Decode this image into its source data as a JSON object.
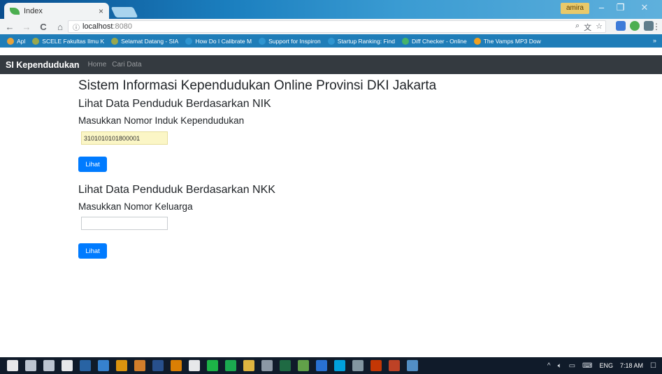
{
  "browser": {
    "tab_title": "Index",
    "tab_close": "×",
    "window_user": "amira",
    "window_buttons": {
      "minimize": "–",
      "maximize": "❐",
      "close": "✕"
    },
    "address": {
      "host": "localhost",
      "port": ":8080"
    },
    "nav_icons": {
      "back": "←",
      "forward": "→",
      "reload": "C",
      "home": "⌂",
      "info": "ⓘ"
    },
    "omnibox_icons": [
      "zoom-icon",
      "translate-icon",
      "star-icon"
    ],
    "bookmarks": [
      {
        "label": "Apl",
        "icon": "apps-icon",
        "color": "#e8a33a"
      },
      {
        "label": "SCELE Fakultas Ilmu K",
        "icon": "scele-icon",
        "color": "#9aa84d"
      },
      {
        "label": "Selamat Datang - SIA",
        "icon": "siak-icon",
        "color": "#9aa84d"
      },
      {
        "label": "How Do I Calibrate M",
        "icon": "page-icon",
        "color": "#2f95d0"
      },
      {
        "label": "Support for Inspiron",
        "icon": "dell-icon",
        "color": "#2f95d0"
      },
      {
        "label": "Startup Ranking: Find",
        "icon": "startup-icon",
        "color": "#2f95d0"
      },
      {
        "label": "Diff Checker - Online",
        "icon": "diff-icon",
        "color": "#46b36a"
      },
      {
        "label": "The Vamps MP3 Dow",
        "icon": "music-icon",
        "color": "#f0a020"
      }
    ],
    "bookmarks_more": "»"
  },
  "navbar": {
    "brand": "SI Kependudukan",
    "links": [
      "Home",
      "Cari Data"
    ]
  },
  "main": {
    "title": "Sistem Informasi Kependudukan Online Provinsi DKI Jakarta",
    "nik_section": {
      "heading": "Lihat Data Penduduk Berdasarkan NIK",
      "label": "Masukkan Nomor Induk Kependudukan",
      "value": "3101010101800001",
      "button": "Lihat"
    },
    "nkk_section": {
      "heading": "Lihat Data Penduduk Berdasarkan NKK",
      "label": "Masukkan Nomor Keluarga",
      "value": "",
      "button": "Lihat"
    }
  },
  "taskbar": {
    "apps": [
      {
        "name": "start-icon",
        "color": "#ffffff"
      },
      {
        "name": "search-icon",
        "color": "#cfd8e3"
      },
      {
        "name": "task-view-icon",
        "color": "#cfd8e3"
      },
      {
        "name": "store-icon",
        "color": "#ffffff"
      },
      {
        "name": "photoshop-icon",
        "color": "#2b6cb0"
      },
      {
        "name": "edge-icon",
        "color": "#3b8de0"
      },
      {
        "name": "chrome-icon",
        "color": "#f2a20c"
      },
      {
        "name": "sublime-icon",
        "color": "#e88a2b"
      },
      {
        "name": "word-icon",
        "color": "#2b5797"
      },
      {
        "name": "vlc-icon",
        "color": "#f18b00"
      },
      {
        "name": "obs-icon",
        "color": "#ffffff"
      },
      {
        "name": "line-icon",
        "color": "#1fc44a"
      },
      {
        "name": "spotify-icon",
        "color": "#1db954"
      },
      {
        "name": "files-icon",
        "color": "#f5c542"
      },
      {
        "name": "explorer-icon",
        "color": "#9aa6b2"
      },
      {
        "name": "excel-icon",
        "color": "#217346"
      },
      {
        "name": "notepad-icon",
        "color": "#6ab04c"
      },
      {
        "name": "app-icon",
        "color": "#2c7be5"
      },
      {
        "name": "skype-icon",
        "color": "#00aff0"
      },
      {
        "name": "settings-icon",
        "color": "#90a4ae"
      },
      {
        "name": "office-icon",
        "color": "#d83b01"
      },
      {
        "name": "powerpoint-icon",
        "color": "#d24726"
      },
      {
        "name": "paint-icon",
        "color": "#5a9bd5"
      }
    ],
    "tray": {
      "up_arrow": "^",
      "language": "ENG",
      "time": "7:18 AM",
      "notification": "☐"
    }
  }
}
